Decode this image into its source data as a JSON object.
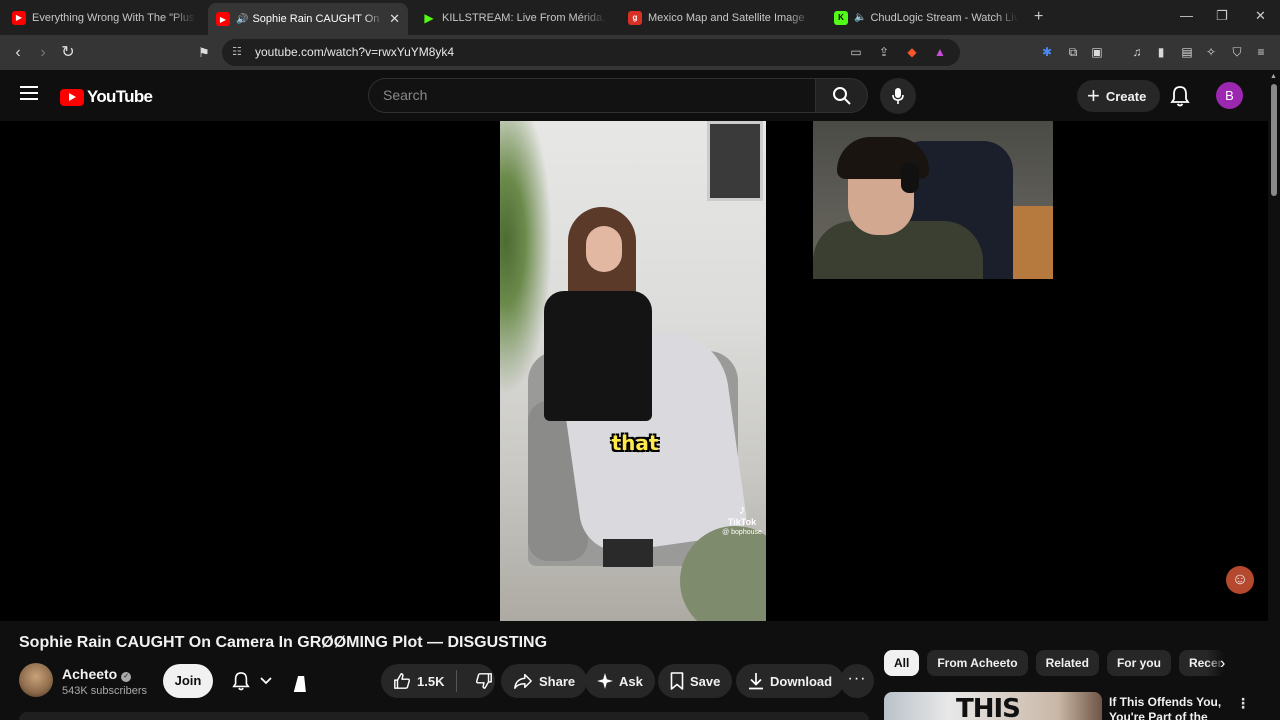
{
  "browser": {
    "tabs": [
      {
        "title": "Everything Wrong With The \"Plus Size",
        "favicon_color": "#ff0000",
        "active": false
      },
      {
        "title": "Sophie Rain CAUGHT On Camera",
        "favicon_color": "#ff0000",
        "active": true,
        "audio": true
      },
      {
        "title": "KILLSTREAM: Live From Mérida, M",
        "favicon_color": "#53fc18",
        "active": false
      },
      {
        "title": "Mexico Map and Satellite Image",
        "favicon_color": "#d93025",
        "active": false
      },
      {
        "title": "ChudLogic Stream - Watch Live o",
        "favicon_color": "#53fc18",
        "active": false,
        "audio": true
      }
    ],
    "url": "youtube.com/watch?v=rwxYuYM8yk4"
  },
  "masthead": {
    "logo_text": "YouTube",
    "search_placeholder": "Search",
    "create_label": "Create",
    "avatar_letter": "B",
    "avatar_color": "#9c27b0"
  },
  "player": {
    "caption": "that",
    "watermark_brand": "TikTok",
    "watermark_handle": "@ bophouse"
  },
  "video": {
    "title": "Sophie Rain CAUGHT On Camera In GRØØMING Plot — DISGUSTING",
    "channel_name": "Acheeto",
    "subscribers": "543K subscribers",
    "join_label": "Join",
    "likes": "1.5K",
    "share_label": "Share",
    "ask_label": "Ask",
    "save_label": "Save",
    "download_label": "Download"
  },
  "sidebar": {
    "chips": [
      "All",
      "From Acheeto",
      "Related",
      "For you",
      "Recent"
    ],
    "recommendation": {
      "thumb_text": "THIS",
      "title": "If This Offends You, You're Part of the"
    }
  }
}
